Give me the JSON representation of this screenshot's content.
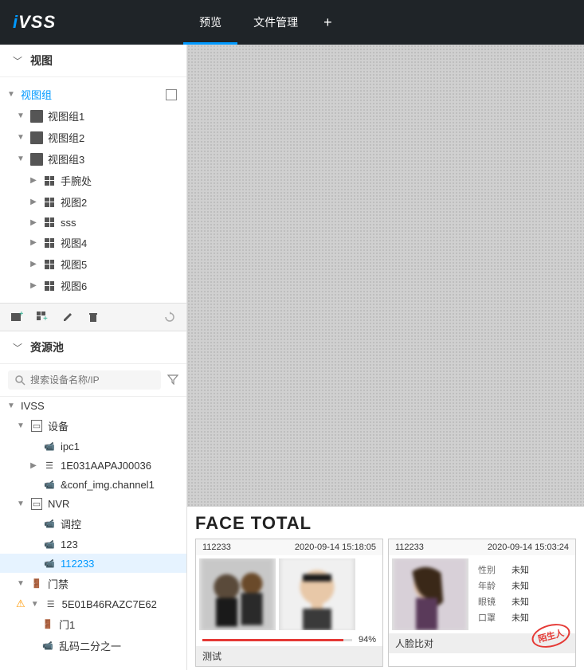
{
  "app": {
    "logo_prefix": "i",
    "logo_rest": "VSS"
  },
  "tabs": {
    "preview": "预览",
    "file_mgmt": "文件管理"
  },
  "sidebar": {
    "view_section": "视图",
    "view_group": "视图组",
    "groups": [
      {
        "label": "视图组1"
      },
      {
        "label": "视图组2"
      },
      {
        "label": "视图组3"
      }
    ],
    "g3_children": [
      {
        "label": "手腕处"
      },
      {
        "label": "视图2"
      },
      {
        "label": "sss"
      },
      {
        "label": "视图4"
      },
      {
        "label": "视图5"
      },
      {
        "label": "视图6"
      }
    ],
    "resource_section": "资源池",
    "search_placeholder": "搜索设备名称/IP",
    "root": "IVSS",
    "devices_label": "设备",
    "devices": [
      {
        "label": "ipc1"
      },
      {
        "label": "1E031AAPAJ00036"
      },
      {
        "label": "&conf_img.channel1"
      }
    ],
    "nvr_label": "NVR",
    "nvr": [
      {
        "label": "调控"
      },
      {
        "label": "123"
      },
      {
        "label": "112233"
      }
    ],
    "access_label": "门禁",
    "access_device": "5E01B46RAZC7E62",
    "access_children": [
      {
        "label": "门1"
      },
      {
        "label": "乱码二分之一"
      }
    ]
  },
  "face": {
    "title": "FACE TOTAL",
    "cards": [
      {
        "channel": "112233",
        "time": "2020-09-14 15:18:05",
        "percent": "94%",
        "footer": "测试"
      },
      {
        "channel": "112233",
        "time": "2020-09-14 15:03:24",
        "attrs": [
          {
            "k": "性别",
            "v": "未知"
          },
          {
            "k": "年龄",
            "v": "未知"
          },
          {
            "k": "眼镜",
            "v": "未知"
          },
          {
            "k": "口罩",
            "v": "未知"
          }
        ],
        "stamp": "陌生人",
        "footer": "人脸比对"
      }
    ]
  }
}
